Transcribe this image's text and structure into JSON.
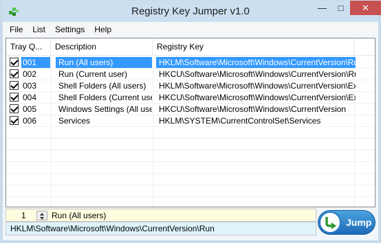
{
  "window": {
    "title": "Registry Key Jumper v1.0",
    "icon": "registry-app-icon",
    "controls": [
      "minimize-icon",
      "maximize-icon",
      "close-icon"
    ]
  },
  "menu": {
    "items": [
      {
        "label": "File"
      },
      {
        "label": "List"
      },
      {
        "label": "Settings"
      },
      {
        "label": "Help"
      }
    ]
  },
  "list": {
    "columns": [
      "Tray Q...",
      "Description",
      "Registry Key"
    ],
    "rows": [
      {
        "checked": true,
        "num": "001",
        "description": "Run (All users)",
        "key": "HKLM\\Software\\Microsoft\\Windows\\CurrentVersion\\Run",
        "selected": true
      },
      {
        "checked": true,
        "num": "002",
        "description": "Run (Current user)",
        "key": "HKCU\\Software\\Microsoft\\Windows\\CurrentVersion\\Run",
        "selected": false
      },
      {
        "checked": true,
        "num": "003",
        "description": "Shell Folders (All users)",
        "key": "HKLM\\Software\\Microsoft\\Windows\\CurrentVersion\\Ex...",
        "selected": false
      },
      {
        "checked": true,
        "num": "004",
        "description": "Shell Folders (Current user)",
        "key": "HKCU\\Software\\Microsoft\\Windows\\CurrentVersion\\Ex...",
        "selected": false
      },
      {
        "checked": true,
        "num": "005",
        "description": "Windows Settings (All users)",
        "key": "HKCU\\Software\\Microsoft\\Windows\\CurrentVersion",
        "selected": false
      },
      {
        "checked": true,
        "num": "006",
        "description": "Services",
        "key": "HKLM\\SYSTEM\\CurrentControlSet\\Services",
        "selected": false
      }
    ]
  },
  "status": {
    "spin_value": "1",
    "selected_label": "Run (All users)",
    "selected_key": "HKLM\\Software\\Microsoft\\Windows\\CurrentVersion\\Run"
  },
  "jump": {
    "label": "Jump",
    "icon": "jump-arrow-icon"
  },
  "colors": {
    "selection": "#3399ff",
    "status_yellow": "#fffde0",
    "status_blue": "#dff3fb",
    "close_red": "#c75050"
  }
}
